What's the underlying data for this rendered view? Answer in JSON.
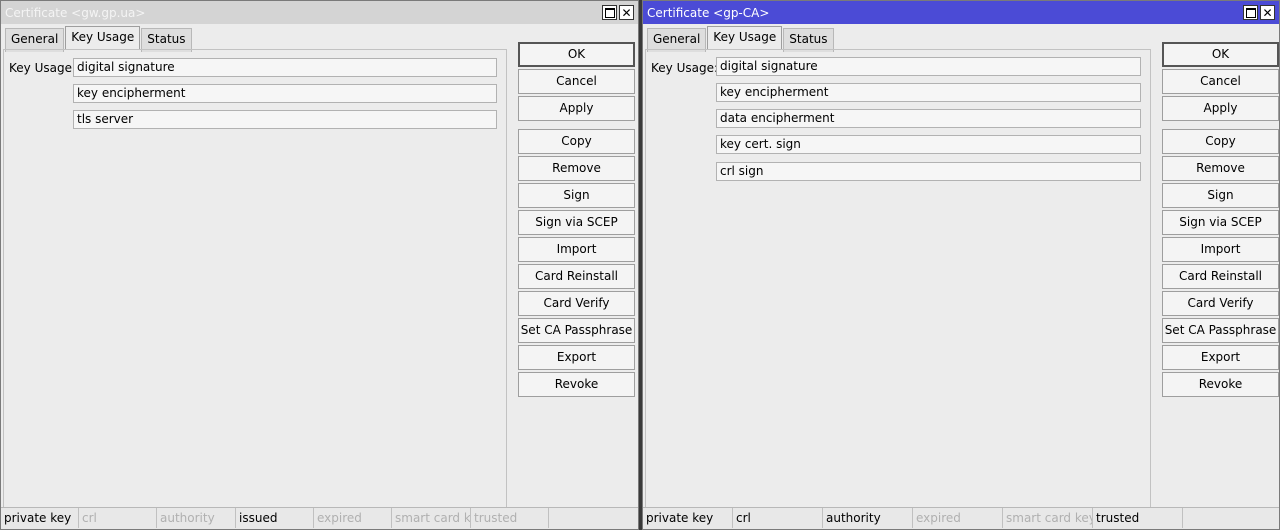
{
  "windows": [
    {
      "title": "Certificate <gw.gp.ua>",
      "tabs": [
        "General",
        "Key Usage",
        "Status"
      ],
      "active_tab": "Key Usage",
      "key_usage_label": "Key Usage:",
      "key_usage_values": [
        "digital signature",
        "key encipherment",
        "tls server"
      ],
      "buttons": [
        "OK",
        "Cancel",
        "Apply",
        "Copy",
        "Remove",
        "Sign",
        "Sign via SCEP",
        "Import",
        "Card Reinstall",
        "Card Verify",
        "Set CA Passphrase",
        "Export",
        "Revoke"
      ],
      "status": [
        {
          "label": "private key",
          "active": true
        },
        {
          "label": "crl",
          "active": false
        },
        {
          "label": "authority",
          "active": false
        },
        {
          "label": "issued",
          "active": true
        },
        {
          "label": "expired",
          "active": false
        },
        {
          "label": "smart card key",
          "active": false
        },
        {
          "label": "trusted",
          "active": false
        },
        {
          "label": "",
          "active": false
        }
      ]
    },
    {
      "title": "Certificate <gp-CA>",
      "tabs": [
        "General",
        "Key Usage",
        "Status"
      ],
      "active_tab": "Key Usage",
      "key_usage_label": "Key Usage:",
      "key_usage_values": [
        "digital signature",
        "key encipherment",
        "data encipherment",
        "key cert. sign",
        "crl sign"
      ],
      "buttons": [
        "OK",
        "Cancel",
        "Apply",
        "Copy",
        "Remove",
        "Sign",
        "Sign via SCEP",
        "Import",
        "Card Reinstall",
        "Card Verify",
        "Set CA Passphrase",
        "Export",
        "Revoke"
      ],
      "status": [
        {
          "label": "private key",
          "active": true
        },
        {
          "label": "crl",
          "active": true
        },
        {
          "label": "authority",
          "active": true
        },
        {
          "label": "expired",
          "active": false
        },
        {
          "label": "smart card key",
          "active": false
        },
        {
          "label": "trusted",
          "active": true
        },
        {
          "label": "",
          "active": false
        }
      ]
    }
  ],
  "window_controls": {
    "maximize_icon": "maximize-icon",
    "close_icon": "close-icon",
    "close_glyph": "✕"
  },
  "colors": {
    "active_titlebar": "#4b4bd6",
    "inactive_titlebar": "#d4d4d4",
    "window_bg": "#ececec"
  }
}
